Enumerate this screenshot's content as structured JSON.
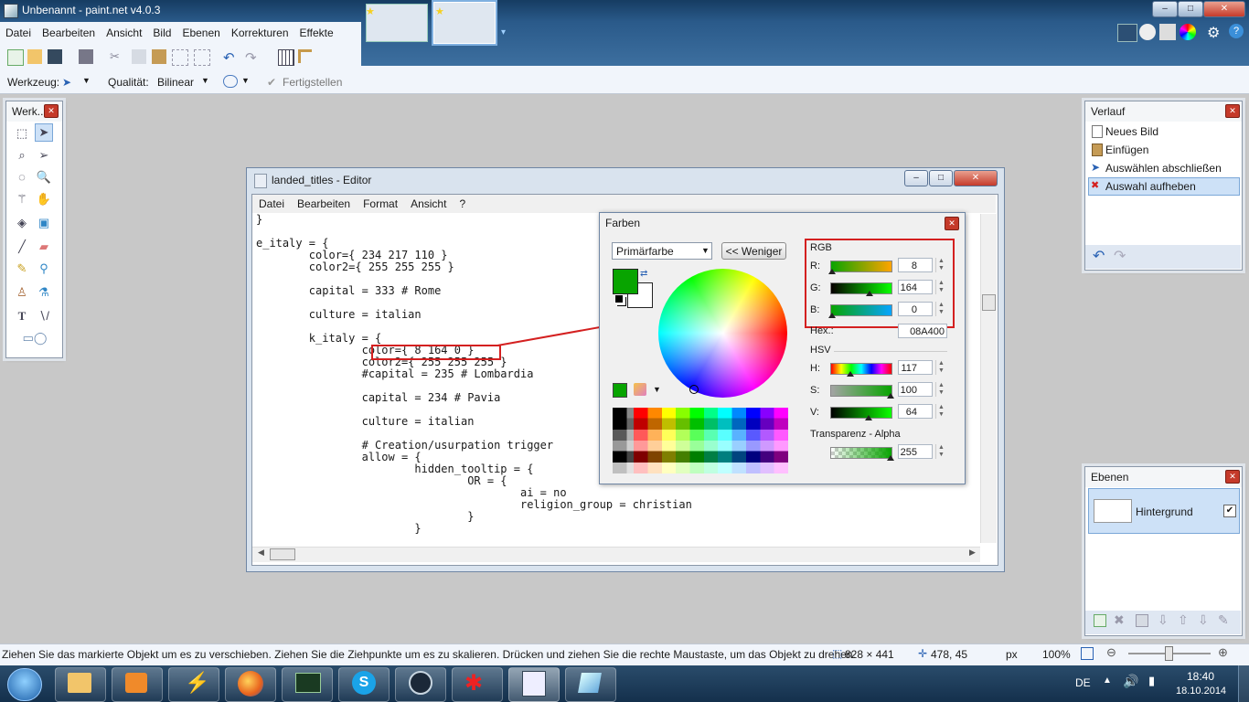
{
  "window": {
    "title": "Unbenannt - paint.net v4.0.3"
  },
  "menu": [
    "Datei",
    "Bearbeiten",
    "Ansicht",
    "Bild",
    "Ebenen",
    "Korrekturen",
    "Effekte"
  ],
  "toolbar2": {
    "tool_label": "Werkzeug:",
    "quality_label": "Qualität:",
    "quality_value": "Bilinear",
    "finish_label": "Fertigstellen"
  },
  "tools_panel": {
    "title": "Werk..."
  },
  "history": {
    "title": "Verlauf",
    "items": [
      "Neues Bild",
      "Einfügen",
      "Auswählen abschließen",
      "Auswahl aufheben"
    ]
  },
  "layers": {
    "title": "Ebenen",
    "items": [
      "Hintergrund"
    ]
  },
  "editor": {
    "title": "landed_titles - Editor",
    "menu": [
      "Datei",
      "Bearbeiten",
      "Format",
      "Ansicht",
      "?"
    ],
    "code": "}\n\ne_italy = {\n\tcolor={ 234 217 110 }\n\tcolor2={ 255 255 255 }\n\n\tcapital = 333 # Rome\n\n\tculture = italian\n\n\tk_italy = {\n\t\tcolor={ 8 164 0 }\n\t\tcolor2={ 255 255 255 }\n\t\t#capital = 235 # Lombardia\n\n\t\tcapital = 234 # Pavia\n\n\t\tculture = italian\n\n\t\t# Creation/usurpation trigger\n\t\tallow = {\n\t\t\thidden_tooltip = {\n\t\t\t\tOR = {\n\t\t\t\t\tai = no\n\t\t\t\t\treligion_group = christian\n\t\t\t\t}\n\t\t\t}"
  },
  "colors_dialog": {
    "title": "Farben",
    "mode": "Primärfarbe",
    "less_button": "<< Weniger",
    "rgb_heading": "RGB",
    "r_label": "R:",
    "r_value": "8",
    "g_label": "G:",
    "g_value": "164",
    "b_label": "B:",
    "b_value": "0",
    "hex_label": "Hex.:",
    "hex_value": "08A400",
    "hsv_heading": "HSV",
    "h_label": "H:",
    "h_value": "117",
    "s_label": "S:",
    "s_value": "100",
    "v_label": "V:",
    "v_value": "64",
    "alpha_heading": "Transparenz - Alpha",
    "alpha_value": "255",
    "primary_color": "#08A400"
  },
  "statusbar": {
    "hint": "Ziehen Sie das markierte Objekt um es zu verschieben. Ziehen Sie die Ziehpunkte um es zu skalieren. Drücken und ziehen Sie die rechte Maustaste, um das Objekt zu drehen.",
    "size": "828 × 441",
    "cursor": "478, 45",
    "unit": "px",
    "zoom": "100%"
  },
  "taskbar": {
    "lang": "DE",
    "time": "18:40",
    "date": "18.10.2014"
  }
}
